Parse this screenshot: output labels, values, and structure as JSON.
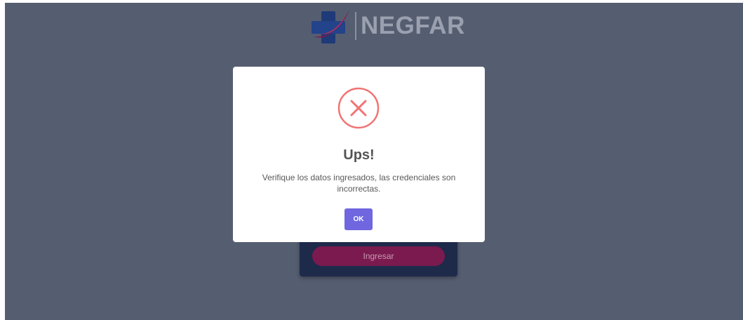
{
  "brand": {
    "name": "NEGFAR",
    "logo_icon": "medical-cross-swoosh-logo"
  },
  "login": {
    "submit_label": "Ingresar"
  },
  "dialog": {
    "icon": "error-x-icon",
    "title": "Ups!",
    "message": "Verifique los datos ingresados, las credenciales son incorrectas.",
    "confirm_label": "OK"
  },
  "colors": {
    "background": "#555d70",
    "login_card": "#1e2a4a",
    "login_button": "#7a1a4e",
    "error_red": "#f27474",
    "confirm_button": "#7066e0"
  }
}
